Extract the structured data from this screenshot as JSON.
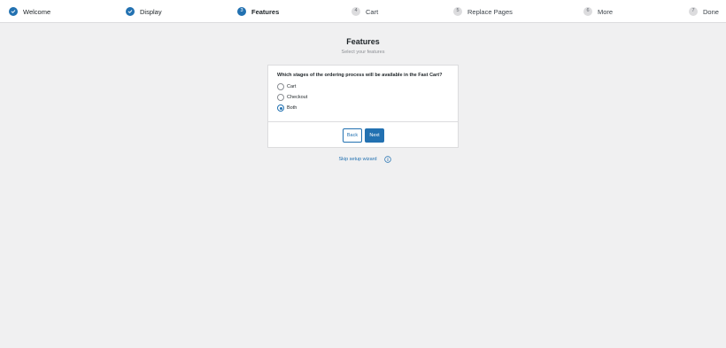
{
  "steps": [
    {
      "number": "1",
      "label": "Welcome",
      "state": "done"
    },
    {
      "number": "2",
      "label": "Display",
      "state": "done"
    },
    {
      "number": "3",
      "label": "Features",
      "state": "current"
    },
    {
      "number": "4",
      "label": "Cart",
      "state": "todo"
    },
    {
      "number": "5",
      "label": "Replace Pages",
      "state": "todo"
    },
    {
      "number": "6",
      "label": "More",
      "state": "todo"
    },
    {
      "number": "7",
      "label": "Done",
      "state": "todo"
    }
  ],
  "page": {
    "title": "Features",
    "subtitle": "Select your features"
  },
  "form": {
    "question": "Which stages of the ordering process will be available in the Fast Cart?",
    "options": [
      {
        "label": "Cart",
        "checked": false
      },
      {
        "label": "Checkout",
        "checked": false
      },
      {
        "label": "Both",
        "checked": true
      }
    ]
  },
  "actions": {
    "back_label": "Back",
    "next_label": "Next"
  },
  "skip": {
    "label": "Skip setup wizard"
  },
  "colors": {
    "accent": "#2271b1",
    "background": "#f0f0f1",
    "card": "#ffffff"
  }
}
